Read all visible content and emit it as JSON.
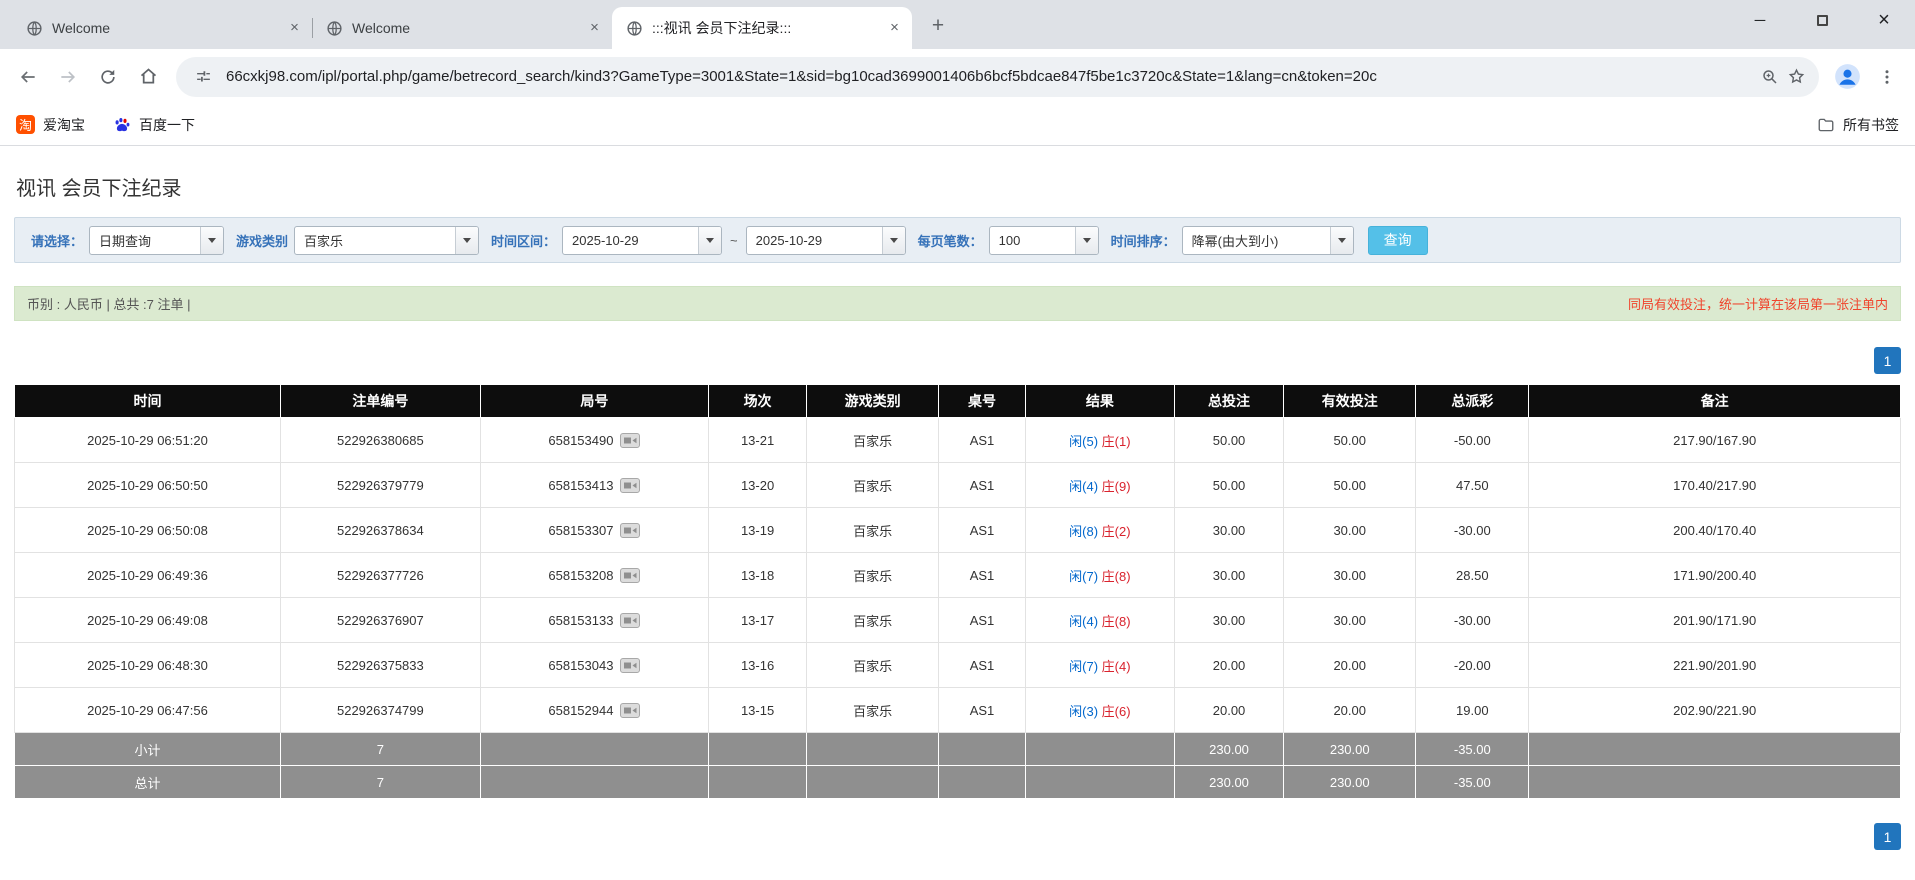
{
  "colors": {
    "header_bg": "#0d0d0d",
    "link_blue": "#0066cc",
    "loss_red": "#e60000",
    "player_blue": "#0066cc",
    "banker_red": "#d9232e",
    "search_button_cyan": "#54c0e8",
    "pagination_blue": "#2175bd",
    "summary_green": "#dbead0",
    "filter_bar_blue": "#e8eef4"
  },
  "browser": {
    "tabs": [
      {
        "title": "Welcome",
        "active": false
      },
      {
        "title": "Welcome",
        "active": false
      },
      {
        "title": ":::视讯 会员下注纪录:::",
        "active": true
      }
    ],
    "url": "66cxkj98.com/ipl/portal.php/game/betrecord_search/kind3?GameType=3001&State=1&sid=bg10cad3699001406b6bcf5bdcae847f5be1c3720c&State=1&lang=cn&token=20c",
    "bookmarks": [
      {
        "label": "爱淘宝"
      },
      {
        "label": "百度一下"
      }
    ],
    "all_bookmarks": "所有书签"
  },
  "page": {
    "title": "视讯 会员下注纪录",
    "filters": {
      "select_label": "请选择：",
      "select_value": "日期查询",
      "game_type_label": "游戏类别",
      "game_type_value": "百家乐",
      "time_range_label": "时间区间：",
      "date_from": "2025-10-29",
      "range_separator": "~",
      "date_to": "2025-10-29",
      "page_size_label": "每页笔数：",
      "page_size_value": "100",
      "sort_label": "时间排序：",
      "sort_value": "降幂(由大到小)",
      "search_button": "查询"
    },
    "summary": {
      "left": "币别 : 人民币 | 总共 :7 注单 |",
      "right": "同局有效投注，统一计算在该局第一张注单内"
    },
    "pagination": {
      "page": "1"
    },
    "table": {
      "headers": [
        "时间",
        "注单编号",
        "局号",
        "场次",
        "游戏类别",
        "桌号",
        "结果",
        "总投注",
        "有效投注",
        "总派彩",
        "备注"
      ],
      "rows": [
        {
          "time": "2025-10-29 06:51:20",
          "bet_id": "522926380685",
          "round": "658153490",
          "session": "13-21",
          "game": "百家乐",
          "table_no": "AS1",
          "result_player": "闲(5)",
          "result_banker": "庄(1)",
          "total_bet": "50.00",
          "valid_bet": "50.00",
          "payout": "-50.00",
          "note": "217.90/167.90"
        },
        {
          "time": "2025-10-29 06:50:50",
          "bet_id": "522926379779",
          "round": "658153413",
          "session": "13-20",
          "game": "百家乐",
          "table_no": "AS1",
          "result_player": "闲(4)",
          "result_banker": "庄(9)",
          "total_bet": "50.00",
          "valid_bet": "50.00",
          "payout": "47.50",
          "note": "170.40/217.90"
        },
        {
          "time": "2025-10-29 06:50:08",
          "bet_id": "522926378634",
          "round": "658153307",
          "session": "13-19",
          "game": "百家乐",
          "table_no": "AS1",
          "result_player": "闲(8)",
          "result_banker": "庄(2)",
          "total_bet": "30.00",
          "valid_bet": "30.00",
          "payout": "-30.00",
          "note": "200.40/170.40"
        },
        {
          "time": "2025-10-29 06:49:36",
          "bet_id": "522926377726",
          "round": "658153208",
          "session": "13-18",
          "game": "百家乐",
          "table_no": "AS1",
          "result_player": "闲(7)",
          "result_banker": "庄(8)",
          "total_bet": "30.00",
          "valid_bet": "30.00",
          "payout": "28.50",
          "note": "171.90/200.40"
        },
        {
          "time": "2025-10-29 06:49:08",
          "bet_id": "522926376907",
          "round": "658153133",
          "session": "13-17",
          "game": "百家乐",
          "table_no": "AS1",
          "result_player": "闲(4)",
          "result_banker": "庄(8)",
          "total_bet": "30.00",
          "valid_bet": "30.00",
          "payout": "-30.00",
          "note": "201.90/171.90"
        },
        {
          "time": "2025-10-29 06:48:30",
          "bet_id": "522926375833",
          "round": "658153043",
          "session": "13-16",
          "game": "百家乐",
          "table_no": "AS1",
          "result_player": "闲(7)",
          "result_banker": "庄(4)",
          "total_bet": "20.00",
          "valid_bet": "20.00",
          "payout": "-20.00",
          "note": "221.90/201.90"
        },
        {
          "time": "2025-10-29 06:47:56",
          "bet_id": "522926374799",
          "round": "658152944",
          "session": "13-15",
          "game": "百家乐",
          "table_no": "AS1",
          "result_player": "闲(3)",
          "result_banker": "庄(6)",
          "total_bet": "20.00",
          "valid_bet": "20.00",
          "payout": "19.00",
          "note": "202.90/221.90"
        }
      ],
      "footer_rows": [
        {
          "label": "小计",
          "count": "7",
          "total_bet": "230.00",
          "valid_bet": "230.00",
          "payout": "-35.00"
        },
        {
          "label": "总计",
          "count": "7",
          "total_bet": "230.00",
          "valid_bet": "230.00",
          "payout": "-35.00"
        }
      ]
    }
  }
}
